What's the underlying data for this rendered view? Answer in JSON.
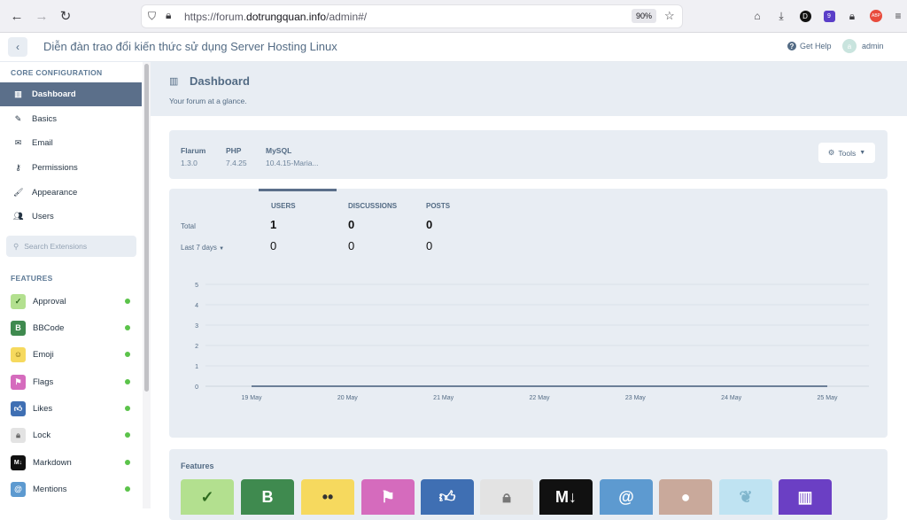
{
  "browser": {
    "url_prefix": "https://forum.",
    "url_domain": "dotrungquan.info",
    "url_suffix": "/admin#/",
    "zoom": "90%"
  },
  "header": {
    "forum_title": "Diễn đàn trao đổi kiến thức sử dụng Server Hosting Linux",
    "help_label": "Get Help",
    "user_name": "admin"
  },
  "sidebar": {
    "core_heading": "CORE CONFIGURATION",
    "core_items": [
      {
        "label": "Dashboard",
        "icon": "chart-icon",
        "active": true
      },
      {
        "label": "Basics",
        "icon": "pencil-icon"
      },
      {
        "label": "Email",
        "icon": "envelope-icon"
      },
      {
        "label": "Permissions",
        "icon": "key-icon"
      },
      {
        "label": "Appearance",
        "icon": "paintbrush-icon"
      },
      {
        "label": "Users",
        "icon": "users-icon"
      }
    ],
    "search_placeholder": "Search Extensions",
    "features_heading": "FEATURES",
    "features": [
      {
        "label": "Approval",
        "color": "#b3e08f",
        "glyph": "✓"
      },
      {
        "label": "BBCode",
        "color": "#3f8a4f",
        "glyph": "B"
      },
      {
        "label": "Emoji",
        "color": "#f6d95e",
        "glyph": "☺"
      },
      {
        "label": "Flags",
        "color": "#d56bbd",
        "glyph": "⚑"
      },
      {
        "label": "Likes",
        "color": "#3f6fb3",
        "glyph": "👍"
      },
      {
        "label": "Lock",
        "color": "#e3e3e3",
        "glyph": "🔒"
      },
      {
        "label": "Markdown",
        "color": "#111111",
        "glyph": "M↓"
      },
      {
        "label": "Mentions",
        "color": "#5d9ad0",
        "glyph": "@"
      }
    ]
  },
  "dashboard": {
    "title": "Dashboard",
    "subtitle": "Your forum at a glance.",
    "versions": [
      {
        "label": "Flarum",
        "value": "1.3.0"
      },
      {
        "label": "PHP",
        "value": "7.4.25"
      },
      {
        "label": "MySQL",
        "value": "10.4.15-Maria..."
      }
    ],
    "tools_label": "Tools",
    "stats": {
      "headers": [
        "USERS",
        "DISCUSSIONS",
        "POSTS"
      ],
      "total_label": "Total",
      "period_label": "Last 7 days",
      "totals": [
        "1",
        "0",
        "0"
      ],
      "period": [
        "0",
        "0",
        "0"
      ]
    },
    "features_title": "Features"
  },
  "chart_data": {
    "type": "line",
    "x": [
      "19 May",
      "20 May",
      "21 May",
      "22 May",
      "23 May",
      "24 May",
      "25 May"
    ],
    "y_ticks": [
      "5",
      "4",
      "3",
      "2",
      "1",
      "0"
    ],
    "series": [
      {
        "values": [
          0,
          0,
          0,
          0,
          0,
          0,
          0
        ]
      }
    ],
    "ylim": [
      0,
      5
    ],
    "grid": true,
    "color": "#5b6f8a"
  },
  "extension_tiles": [
    {
      "color": "#b3e08f",
      "glyph": "✓"
    },
    {
      "color": "#3f8a4f",
      "glyph": "B"
    },
    {
      "color": "#f6d95e",
      "glyph": "••"
    },
    {
      "color": "#d56bbd",
      "glyph": "⚑"
    },
    {
      "color": "#3f6fb3",
      "glyph": "👍"
    },
    {
      "color": "#e3e3e3",
      "glyph": "🔒"
    },
    {
      "color": "#111111",
      "glyph": "M↓"
    },
    {
      "color": "#5d9ad0",
      "glyph": "@"
    },
    {
      "color": "#c9a99b",
      "glyph": "●"
    },
    {
      "color": "#bfe3f2",
      "glyph": "❦"
    },
    {
      "color": "#6b3fc4",
      "glyph": "▥"
    }
  ]
}
